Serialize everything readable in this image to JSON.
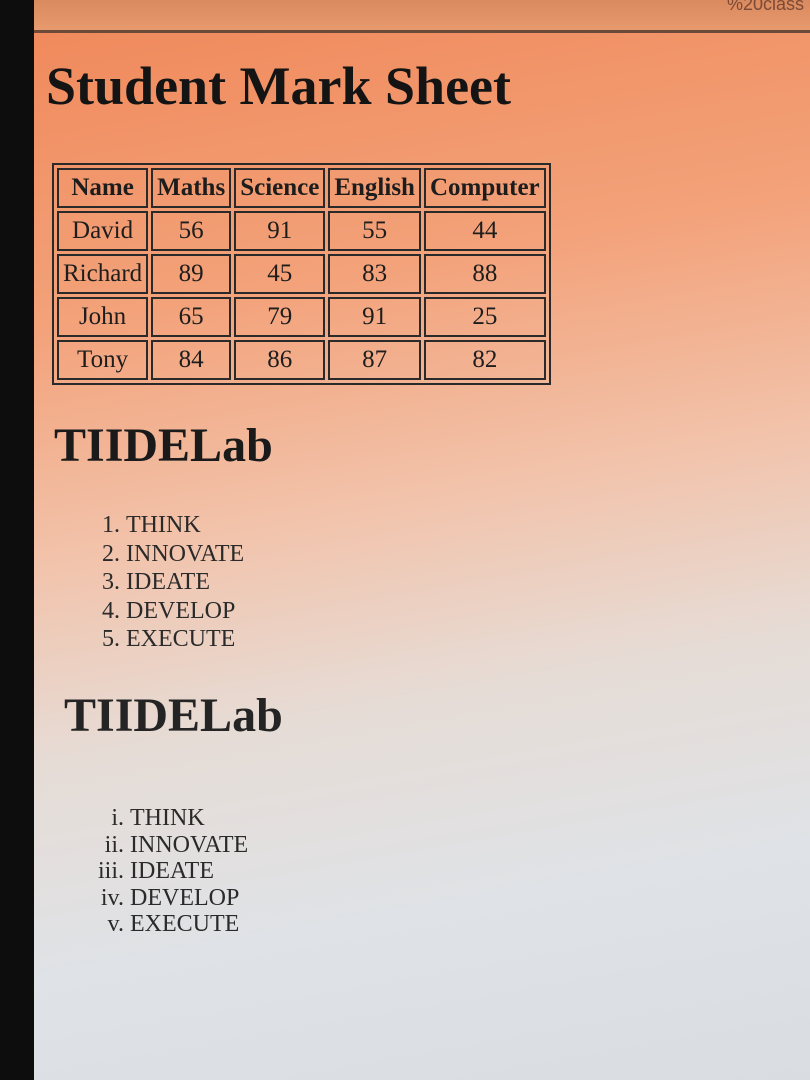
{
  "browser": {
    "url_fragment": "%20class"
  },
  "heading": "Student Mark Sheet",
  "table": {
    "headers": [
      "Name",
      "Maths",
      "Science",
      "English",
      "Computer"
    ],
    "rows": [
      [
        "David",
        "56",
        "91",
        "55",
        "44"
      ],
      [
        "Richard",
        "89",
        "45",
        "83",
        "88"
      ],
      [
        "John",
        "65",
        "79",
        "91",
        "25"
      ],
      [
        "Tony",
        "84",
        "86",
        "87",
        "82"
      ]
    ]
  },
  "sections": [
    {
      "title": "TIIDELab",
      "list_style": "decimal",
      "items": [
        "THINK",
        "INNOVATE",
        "IDEATE",
        "DEVELOP",
        "EXECUTE"
      ]
    },
    {
      "title": "TIIDELab",
      "list_style": "lower-roman",
      "items": [
        "THINK",
        "INNOVATE",
        "IDEATE",
        "DEVELOP",
        "EXECUTE"
      ]
    }
  ]
}
